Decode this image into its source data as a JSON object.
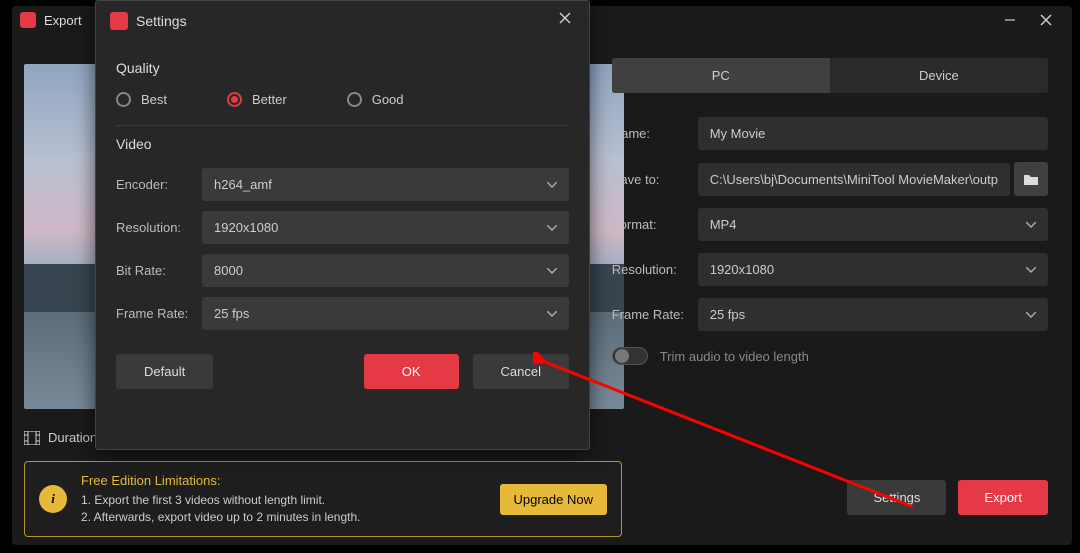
{
  "titlebar": {
    "title": "Export"
  },
  "preview": {
    "duration_label": "Duration"
  },
  "right": {
    "tabs": {
      "pc": "PC",
      "device": "Device"
    },
    "name_label": "Name:",
    "name_value": "My Movie",
    "saveto_label": "Save to:",
    "saveto_value": "C:\\Users\\bj\\Documents\\MiniTool MovieMaker\\outp",
    "format_label": "Format:",
    "format_value": "MP4",
    "resolution_label": "Resolution:",
    "resolution_value": "1920x1080",
    "framerate_label": "Frame Rate:",
    "framerate_value": "25 fps",
    "toggle_label": "Trim audio to video length",
    "settings_btn": "Settings",
    "export_btn": "Export"
  },
  "limits": {
    "heading": "Free Edition Limitations:",
    "line1": "1. Export the first 3 videos without length limit.",
    "line2": "2. Afterwards, export video up to 2 minutes in length.",
    "upgrade": "Upgrade Now"
  },
  "dialog": {
    "title": "Settings",
    "quality_h": "Quality",
    "best": "Best",
    "better": "Better",
    "good": "Good",
    "video_h": "Video",
    "encoder_label": "Encoder:",
    "encoder_value": "h264_amf",
    "resolution_label": "Resolution:",
    "resolution_value": "1920x1080",
    "bitrate_label": "Bit Rate:",
    "bitrate_value": "8000",
    "framerate_label": "Frame Rate:",
    "framerate_value": "25 fps",
    "default_btn": "Default",
    "ok_btn": "OK",
    "cancel_btn": "Cancel"
  }
}
